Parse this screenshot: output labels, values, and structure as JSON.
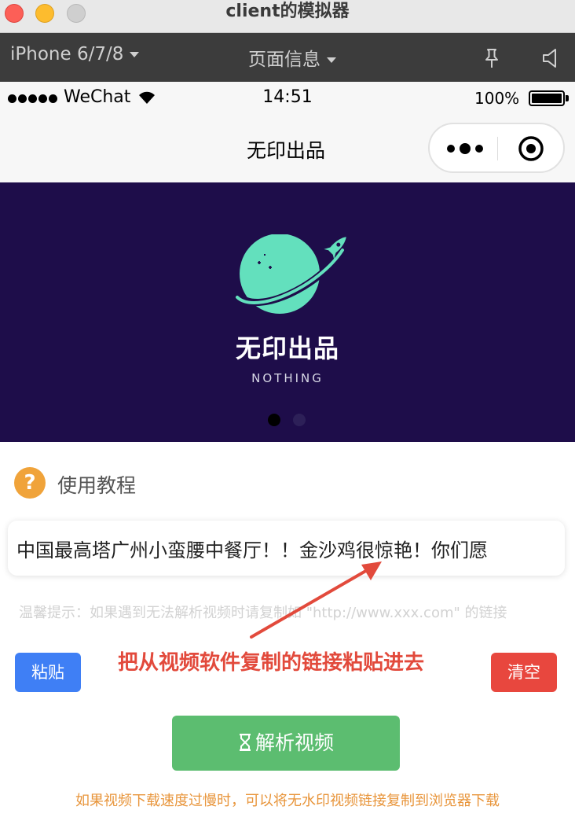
{
  "window": {
    "title": "client的模拟器"
  },
  "simulator": {
    "device": "iPhone 6/7/8",
    "page_info": "页面信息"
  },
  "statusbar": {
    "carrier": "WeChat",
    "time": "14:51",
    "battery": "100%"
  },
  "navbar": {
    "title": "无印出品"
  },
  "banner": {
    "brand": "无印出品",
    "subtitle": "NOTHING",
    "slides": 2,
    "active_slide": 1
  },
  "tutorial": {
    "label": "使用教程"
  },
  "link_input": {
    "value": "中国最高塔广州小蛮腰中餐厅！！金沙鸡很惊艳！你们愿"
  },
  "hint": {
    "text": "温馨提示：如果遇到无法解析视频时请复制如 \"http://www.xxx.com\" 的链接"
  },
  "annotation": {
    "text": "把从视频软件复制的链接粘贴进去"
  },
  "buttons": {
    "paste": "粘贴",
    "clear": "清空",
    "parse": "解析视频"
  },
  "footer": {
    "text": "如果视频下载速度过慢时，可以将无水印视频链接复制到浏览器下载"
  },
  "colors": {
    "banner_bg": "#1e0d4a",
    "planet": "#63e0bd",
    "paste": "#3f7ff5",
    "clear": "#e8473e",
    "parse": "#5cbd70",
    "annotation": "#e24a3c",
    "footer": "#e8953b"
  },
  "icons": {
    "pin": "pin-icon",
    "speaker": "speaker-icon",
    "more": "more-dots-icon",
    "close": "target-icon",
    "help": "question-icon",
    "parse": "hourglass-icon"
  }
}
